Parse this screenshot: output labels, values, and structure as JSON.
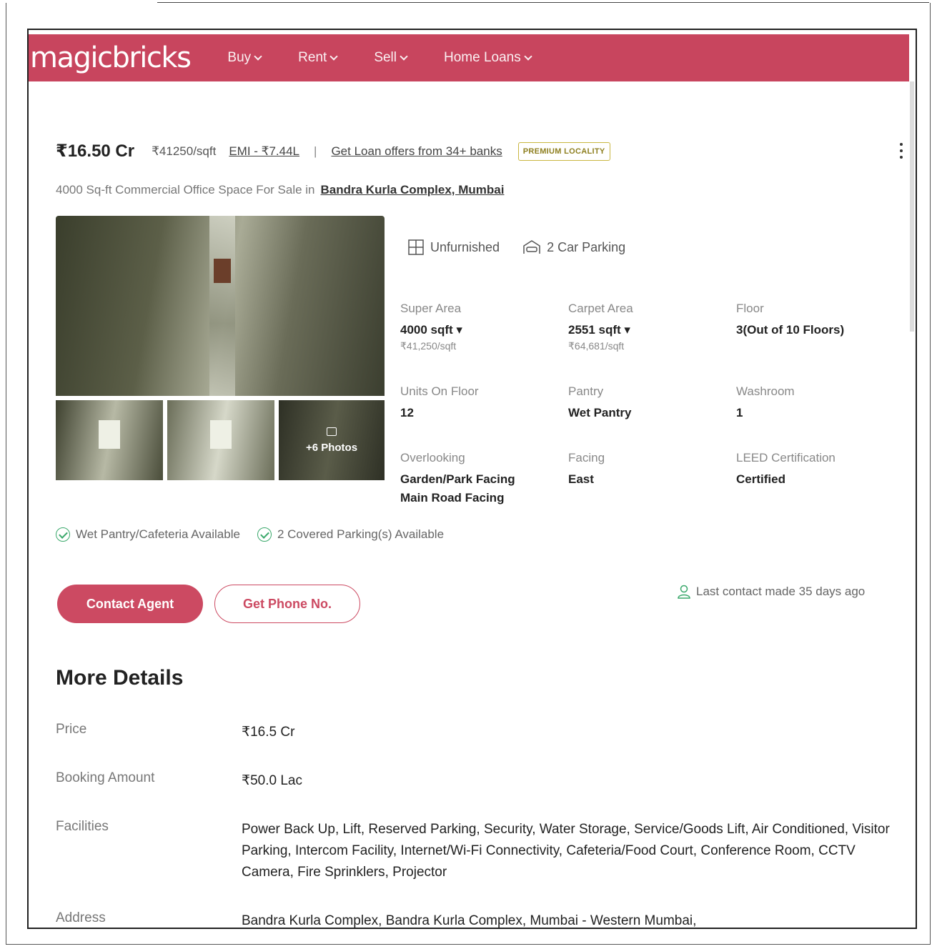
{
  "nav": {
    "logo": "magicbricks",
    "items": [
      {
        "label": "Buy"
      },
      {
        "label": "Rent"
      },
      {
        "label": "Sell"
      },
      {
        "label": "Home Loans"
      }
    ]
  },
  "listing": {
    "price": "₹16.50 Cr",
    "price_per_sqft": "₹41250/sqft",
    "emi": "EMI - ₹7.44L",
    "separator": "|",
    "loan_offer": "Get Loan offers from 34+ banks",
    "badge": "PREMIUM LOCALITY",
    "subtitle": "4000 Sq-ft Commercial Office Space For Sale in",
    "locality": "Bandra Kurla Complex, Mumbai",
    "more_photos": "+6 Photos",
    "features": {
      "furnishing": "Unfurnished",
      "parking": "2 Car Parking"
    }
  },
  "specs": {
    "super_area": {
      "label": "Super Area",
      "value": "4000 sqft",
      "sub": "₹41,250/sqft"
    },
    "carpet_area": {
      "label": "Carpet Area",
      "value": "2551 sqft",
      "sub": "₹64,681/sqft"
    },
    "floor": {
      "label": "Floor",
      "value": "3(Out of 10 Floors)"
    },
    "units_on_floor": {
      "label": "Units On Floor",
      "value": "12"
    },
    "pantry": {
      "label": "Pantry",
      "value": "Wet Pantry"
    },
    "washroom": {
      "label": "Washroom",
      "value": "1"
    },
    "overlooking": {
      "label": "Overlooking",
      "value": "Garden/Park Facing",
      "value2": "Main Road Facing"
    },
    "facing": {
      "label": "Facing",
      "value": "East"
    },
    "leed": {
      "label": "LEED Certification",
      "value": "Certified"
    }
  },
  "availability": [
    "Wet Pantry/Cafeteria Available",
    "2 Covered Parking(s) Available"
  ],
  "actions": {
    "contact_agent": "Contact Agent",
    "get_phone": "Get Phone No.",
    "last_contact": "Last contact made 35 days ago"
  },
  "more_details": {
    "title": "More Details",
    "rows": [
      {
        "label": "Price",
        "value": "₹16.5 Cr"
      },
      {
        "label": "Booking Amount",
        "value": "₹50.0 Lac"
      },
      {
        "label": "Facilities",
        "value": "Power Back Up, Lift, Reserved Parking, Security, Water Storage, Service/Goods Lift, Air Conditioned, Visitor Parking, Intercom Facility, Internet/Wi-Fi Connectivity, Cafeteria/Food Court, Conference Room, CCTV Camera, Fire Sprinklers, Projector"
      },
      {
        "label": "Address",
        "value": "Bandra Kurla Complex, Bandra Kurla Complex, Mumbai - Western Mumbai,"
      }
    ]
  },
  "colors": {
    "brand": "#c8455e",
    "button": "#cc4a62",
    "success": "#3aa86b",
    "badge": "#c9b640"
  }
}
